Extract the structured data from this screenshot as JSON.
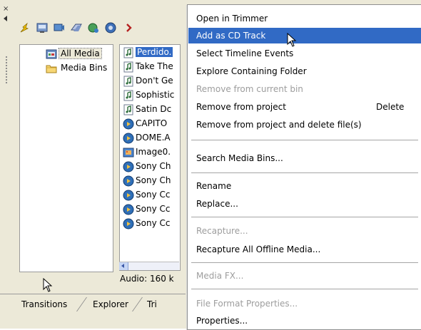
{
  "tree": {
    "items": [
      {
        "label": "All Media"
      },
      {
        "label": "Media Bins"
      }
    ]
  },
  "list": {
    "items": [
      {
        "label": "Perdido.",
        "icon": "audio-file-icon"
      },
      {
        "label": "Take The",
        "icon": "audio-file-icon"
      },
      {
        "label": "Don't Ge",
        "icon": "audio-file-icon"
      },
      {
        "label": "Sophistic",
        "icon": "audio-file-icon"
      },
      {
        "label": "Satin Dc",
        "icon": "audio-file-icon"
      },
      {
        "label": "CAPITO",
        "icon": "video-file-icon"
      },
      {
        "label": "DOME.A",
        "icon": "video-file-icon"
      },
      {
        "label": "Image0.",
        "icon": "image-file-icon"
      },
      {
        "label": "Sony Ch",
        "icon": "video-file-icon"
      },
      {
        "label": "Sony Ch",
        "icon": "video-file-icon"
      },
      {
        "label": "Sony Cc",
        "icon": "video-file-icon"
      },
      {
        "label": "Sony Cc",
        "icon": "video-file-icon"
      },
      {
        "label": "Sony Cc",
        "icon": "video-file-icon"
      }
    ]
  },
  "status": {
    "text": "Audio: 160 k"
  },
  "tabs": [
    {
      "label": "Transitions"
    },
    {
      "label": "Explorer"
    },
    {
      "label": "Tri"
    }
  ],
  "menu": {
    "items": [
      {
        "label": "Open in Trimmer",
        "shortcut": "",
        "disabled": false,
        "highlighted": false
      },
      {
        "label": "Add as CD Track",
        "shortcut": "",
        "disabled": false,
        "highlighted": true
      },
      {
        "label": "Select Timeline Events",
        "shortcut": "",
        "disabled": false,
        "highlighted": false
      },
      {
        "label": "Explore Containing Folder",
        "shortcut": "",
        "disabled": false,
        "highlighted": false
      },
      {
        "label": "Remove from current bin",
        "shortcut": "",
        "disabled": true,
        "highlighted": false
      },
      {
        "label": "Remove from project",
        "shortcut": "Delete",
        "disabled": false,
        "highlighted": false
      },
      {
        "label": "Remove from project and delete file(s)",
        "shortcut": "",
        "disabled": false,
        "highlighted": false
      },
      {
        "label": "Search Media Bins...",
        "shortcut": "",
        "disabled": false,
        "highlighted": false
      },
      {
        "label": "Rename",
        "shortcut": "",
        "disabled": false,
        "highlighted": false
      },
      {
        "label": "Replace...",
        "shortcut": "",
        "disabled": false,
        "highlighted": false
      },
      {
        "label": "Recapture...",
        "shortcut": "",
        "disabled": true,
        "highlighted": false
      },
      {
        "label": "Recapture All Offline Media...",
        "shortcut": "",
        "disabled": false,
        "highlighted": false
      },
      {
        "label": "Media FX...",
        "shortcut": "",
        "disabled": true,
        "highlighted": false
      },
      {
        "label": "File Format Properties...",
        "shortcut": "",
        "disabled": true,
        "highlighted": false
      },
      {
        "label": "Properties...",
        "shortcut": "",
        "disabled": false,
        "highlighted": false
      }
    ]
  },
  "colors": {
    "highlight": "#316ac5",
    "panel": "#ece9d8",
    "disabled_text": "#9d9d9d"
  }
}
